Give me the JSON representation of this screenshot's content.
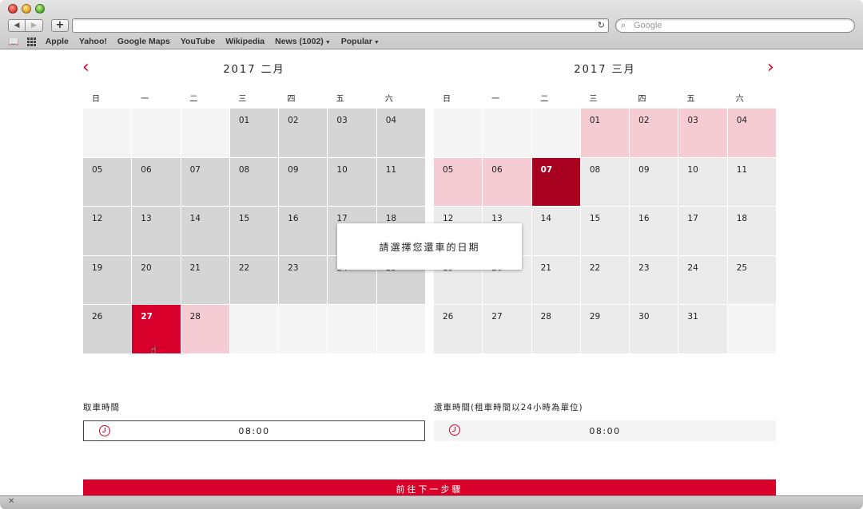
{
  "browser": {
    "search_placeholder": "Google",
    "bookmarks": [
      "Apple",
      "Yahoo!",
      "Google Maps",
      "YouTube",
      "Wikipedia",
      "News (1002)",
      "Popular"
    ]
  },
  "calendar": {
    "accent_color": "#d8002a",
    "weekdays": [
      "日",
      "一",
      "二",
      "三",
      "四",
      "五",
      "六"
    ],
    "months": [
      {
        "title": "2017 二月",
        "cells": [
          {
            "t": "",
            "s": "blank"
          },
          {
            "t": "",
            "s": "blank"
          },
          {
            "t": "",
            "s": "blank"
          },
          {
            "t": "01",
            "s": "past"
          },
          {
            "t": "02",
            "s": "past"
          },
          {
            "t": "03",
            "s": "past"
          },
          {
            "t": "04",
            "s": "past"
          },
          {
            "t": "05",
            "s": "past"
          },
          {
            "t": "06",
            "s": "past"
          },
          {
            "t": "07",
            "s": "past"
          },
          {
            "t": "08",
            "s": "past"
          },
          {
            "t": "09",
            "s": "past"
          },
          {
            "t": "10",
            "s": "past"
          },
          {
            "t": "11",
            "s": "past"
          },
          {
            "t": "12",
            "s": "past"
          },
          {
            "t": "13",
            "s": "past"
          },
          {
            "t": "14",
            "s": "past"
          },
          {
            "t": "15",
            "s": "past"
          },
          {
            "t": "16",
            "s": "past"
          },
          {
            "t": "17",
            "s": "past"
          },
          {
            "t": "18",
            "s": "past"
          },
          {
            "t": "19",
            "s": "past"
          },
          {
            "t": "20",
            "s": "past"
          },
          {
            "t": "21",
            "s": "past"
          },
          {
            "t": "22",
            "s": "past"
          },
          {
            "t": "23",
            "s": "past"
          },
          {
            "t": "24",
            "s": "past"
          },
          {
            "t": "25",
            "s": "past"
          },
          {
            "t": "26",
            "s": "past"
          },
          {
            "t": "27",
            "s": "sel-start"
          },
          {
            "t": "28",
            "s": "range"
          },
          {
            "t": "",
            "s": "blank"
          },
          {
            "t": "",
            "s": "blank"
          },
          {
            "t": "",
            "s": "blank"
          },
          {
            "t": "",
            "s": "blank"
          }
        ]
      },
      {
        "title": "2017 三月",
        "cells": [
          {
            "t": "",
            "s": "blank"
          },
          {
            "t": "",
            "s": "blank"
          },
          {
            "t": "",
            "s": "blank"
          },
          {
            "t": "01",
            "s": "range"
          },
          {
            "t": "02",
            "s": "range"
          },
          {
            "t": "03",
            "s": "range"
          },
          {
            "t": "04",
            "s": "range"
          },
          {
            "t": "05",
            "s": "range"
          },
          {
            "t": "06",
            "s": "range"
          },
          {
            "t": "07",
            "s": "sel-end"
          },
          {
            "t": "08",
            "s": "avail"
          },
          {
            "t": "09",
            "s": "avail"
          },
          {
            "t": "10",
            "s": "avail"
          },
          {
            "t": "11",
            "s": "avail"
          },
          {
            "t": "12",
            "s": "avail"
          },
          {
            "t": "13",
            "s": "avail"
          },
          {
            "t": "14",
            "s": "avail"
          },
          {
            "t": "15",
            "s": "avail"
          },
          {
            "t": "16",
            "s": "avail"
          },
          {
            "t": "17",
            "s": "avail"
          },
          {
            "t": "18",
            "s": "avail"
          },
          {
            "t": "19",
            "s": "avail"
          },
          {
            "t": "20",
            "s": "avail"
          },
          {
            "t": "21",
            "s": "avail"
          },
          {
            "t": "22",
            "s": "avail"
          },
          {
            "t": "23",
            "s": "avail"
          },
          {
            "t": "24",
            "s": "avail"
          },
          {
            "t": "25",
            "s": "avail"
          },
          {
            "t": "26",
            "s": "avail"
          },
          {
            "t": "27",
            "s": "avail"
          },
          {
            "t": "28",
            "s": "avail"
          },
          {
            "t": "29",
            "s": "avail"
          },
          {
            "t": "30",
            "s": "avail"
          },
          {
            "t": "31",
            "s": "avail"
          },
          {
            "t": "",
            "s": "blank"
          }
        ]
      }
    ],
    "tooltip": "請選擇您還車的日期"
  },
  "pickup": {
    "label": "取車時間",
    "value": "08:00"
  },
  "return": {
    "label": "還車時間(租車時間以24小時為單位)",
    "value": "08:00"
  },
  "next_button": "前往下一步驟"
}
